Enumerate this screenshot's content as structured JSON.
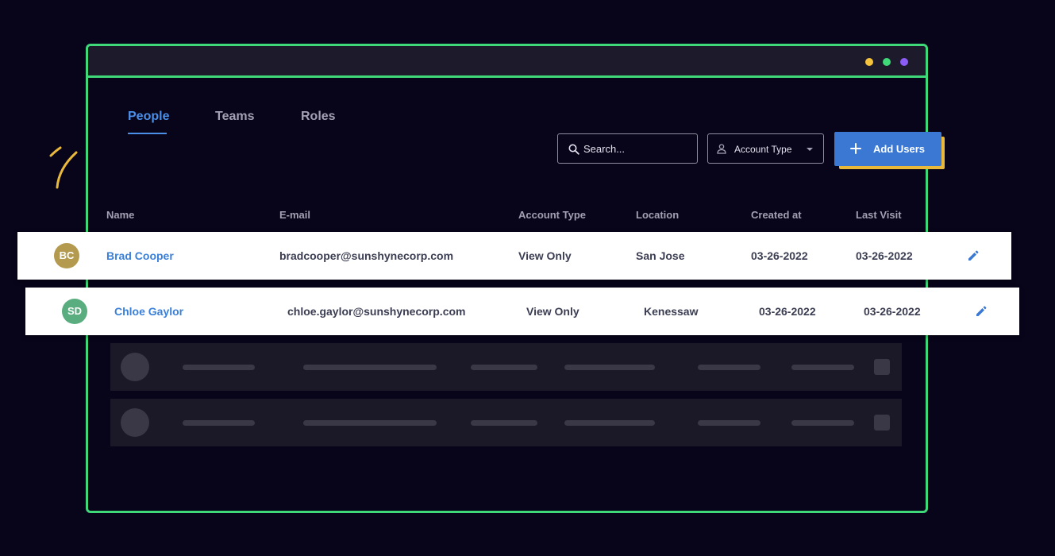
{
  "window": {
    "dots": [
      {
        "name": "yellow",
        "color": "#f5c33b"
      },
      {
        "name": "green",
        "color": "#3fd97a"
      },
      {
        "name": "purple",
        "color": "#8b5cf6"
      }
    ]
  },
  "tabs": [
    {
      "label": "People",
      "active": true
    },
    {
      "label": "Teams",
      "active": false
    },
    {
      "label": "Roles",
      "active": false
    }
  ],
  "toolbar": {
    "search_placeholder": "Search...",
    "search_icon": "search-icon",
    "filter_label": "Account Type",
    "filter_icon": "user-icon",
    "add_label": "Add Users",
    "add_icon": "plus-icon"
  },
  "table": {
    "columns": [
      "Name",
      "E-mail",
      "Account Type",
      "Location",
      "Created at",
      "Last Visit"
    ],
    "rows": [
      {
        "initials": "BC",
        "avatar_color": "#b39a4f",
        "name": "Brad Cooper",
        "email": "bradcooper@sunshynecorp.com",
        "account_type": "View Only",
        "location": "San Jose",
        "created": "03-26-2022",
        "last_visit": "03-26-2022",
        "action_icon": "pencil-icon"
      },
      {
        "initials": "SD",
        "avatar_color": "#5aad7e",
        "name": "Chloe Gaylor",
        "email": "chloe.gaylor@sunshynecorp.com",
        "account_type": "View Only",
        "location": "Kenessaw",
        "created": "03-26-2022",
        "last_visit": "03-26-2022",
        "action_icon": "pencil-icon"
      }
    ]
  },
  "colors": {
    "background": "#08041a",
    "frame_border": "#3fd97a",
    "accent": "#3a78d4",
    "accent_shadow": "#e9b93c",
    "link": "#3a80d9"
  }
}
